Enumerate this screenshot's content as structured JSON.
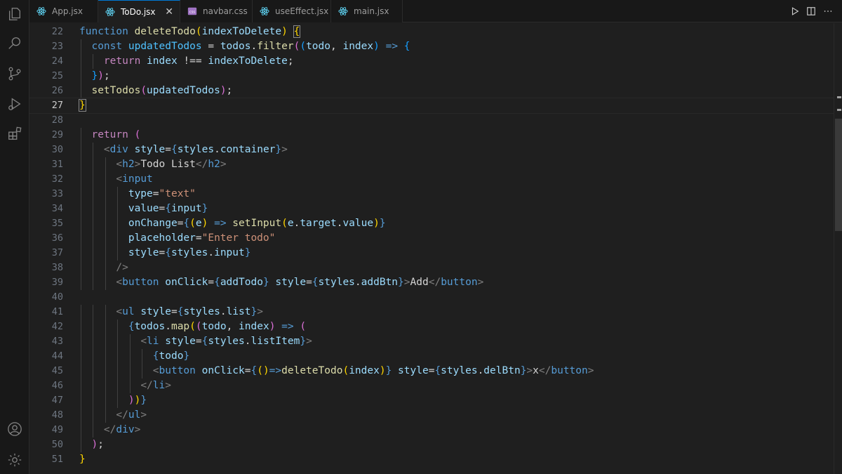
{
  "tabs": [
    {
      "label": "App.jsx",
      "icon": "react-icon",
      "active": false
    },
    {
      "label": "ToDo.jsx",
      "icon": "react-icon",
      "active": true
    },
    {
      "label": "navbar.css",
      "icon": "css-file-icon",
      "active": false
    },
    {
      "label": "useEffect.jsx",
      "icon": "react-icon",
      "active": false
    },
    {
      "label": "main.jsx",
      "icon": "react-icon",
      "active": false
    }
  ],
  "close_glyph": "✕",
  "activity_icons": [
    "explorer-icon",
    "search-icon",
    "source-control-icon",
    "run-debug-icon",
    "extensions-icon",
    "account-icon",
    "settings-gear-icon"
  ],
  "editor": {
    "current_line": "27",
    "lines": [
      {
        "n": "22",
        "tokens": [
          [
            "function",
            "t-kw"
          ],
          [
            " ",
            "t-text"
          ],
          [
            "deleteTodo",
            "t-fn"
          ],
          [
            "(",
            "t-b1"
          ],
          [
            "indexToDelete",
            "t-var"
          ],
          [
            ")",
            "t-b1"
          ],
          [
            " ",
            "t-text"
          ],
          [
            "{",
            "t-b1 t-bm"
          ]
        ]
      },
      {
        "n": "23",
        "tokens": [
          [
            "  ",
            "t-text"
          ],
          [
            "const",
            "t-kw"
          ],
          [
            " ",
            "t-text"
          ],
          [
            "updatedTodos",
            "t-const"
          ],
          [
            " = ",
            "t-punc"
          ],
          [
            "todos",
            "t-var"
          ],
          [
            ".",
            "t-punc"
          ],
          [
            "filter",
            "t-fn"
          ],
          [
            "(",
            "t-b2"
          ],
          [
            "(",
            "t-b3"
          ],
          [
            "todo",
            "t-var"
          ],
          [
            ", ",
            "t-punc"
          ],
          [
            "index",
            "t-var"
          ],
          [
            ")",
            "t-b3"
          ],
          [
            " => ",
            "t-kw"
          ],
          [
            "{",
            "t-b3"
          ]
        ]
      },
      {
        "n": "24",
        "tokens": [
          [
            "    ",
            "t-text"
          ],
          [
            "return",
            "t-ctl"
          ],
          [
            " ",
            "t-text"
          ],
          [
            "index",
            "t-var"
          ],
          [
            " !== ",
            "t-punc"
          ],
          [
            "indexToDelete",
            "t-var"
          ],
          [
            ";",
            "t-punc"
          ]
        ]
      },
      {
        "n": "25",
        "tokens": [
          [
            "  ",
            "t-text"
          ],
          [
            "}",
            "t-b3"
          ],
          [
            ")",
            "t-b2"
          ],
          [
            ";",
            "t-punc"
          ]
        ]
      },
      {
        "n": "26",
        "tokens": [
          [
            "  ",
            "t-text"
          ],
          [
            "setTodos",
            "t-fn"
          ],
          [
            "(",
            "t-b2"
          ],
          [
            "updatedTodos",
            "t-var"
          ],
          [
            ")",
            "t-b2"
          ],
          [
            ";",
            "t-punc"
          ]
        ]
      },
      {
        "n": "27",
        "tokens": [
          [
            "}",
            "t-b1 t-bm"
          ]
        ]
      },
      {
        "n": "28",
        "tokens": []
      },
      {
        "n": "29",
        "tokens": [
          [
            "  ",
            "t-text"
          ],
          [
            "return",
            "t-ctl"
          ],
          [
            " ",
            "t-text"
          ],
          [
            "(",
            "t-b2"
          ]
        ]
      },
      {
        "n": "30",
        "tokens": [
          [
            "    ",
            "t-text"
          ],
          [
            "<",
            "t-tagp"
          ],
          [
            "div",
            "t-tag"
          ],
          [
            " ",
            "t-text"
          ],
          [
            "style",
            "t-attr"
          ],
          [
            "=",
            "t-punc"
          ],
          [
            "{",
            "t-kw"
          ],
          [
            "styles",
            "t-var"
          ],
          [
            ".",
            "t-punc"
          ],
          [
            "container",
            "t-var"
          ],
          [
            "}",
            "t-kw"
          ],
          [
            ">",
            "t-tagp"
          ]
        ]
      },
      {
        "n": "31",
        "tokens": [
          [
            "      ",
            "t-text"
          ],
          [
            "<",
            "t-tagp"
          ],
          [
            "h2",
            "t-tag"
          ],
          [
            ">",
            "t-tagp"
          ],
          [
            "Todo List",
            "t-text"
          ],
          [
            "</",
            "t-tagp"
          ],
          [
            "h2",
            "t-tag"
          ],
          [
            ">",
            "t-tagp"
          ]
        ]
      },
      {
        "n": "32",
        "tokens": [
          [
            "      ",
            "t-text"
          ],
          [
            "<",
            "t-tagp"
          ],
          [
            "input",
            "t-tag"
          ]
        ]
      },
      {
        "n": "33",
        "tokens": [
          [
            "        ",
            "t-text"
          ],
          [
            "type",
            "t-attr"
          ],
          [
            "=",
            "t-punc"
          ],
          [
            "\"text\"",
            "t-str"
          ]
        ]
      },
      {
        "n": "34",
        "tokens": [
          [
            "        ",
            "t-text"
          ],
          [
            "value",
            "t-attr"
          ],
          [
            "=",
            "t-punc"
          ],
          [
            "{",
            "t-kw"
          ],
          [
            "input",
            "t-var"
          ],
          [
            "}",
            "t-kw"
          ]
        ]
      },
      {
        "n": "35",
        "tokens": [
          [
            "        ",
            "t-text"
          ],
          [
            "onChange",
            "t-attr"
          ],
          [
            "=",
            "t-punc"
          ],
          [
            "{",
            "t-kw"
          ],
          [
            "(",
            "t-b1"
          ],
          [
            "e",
            "t-var"
          ],
          [
            ")",
            "t-b1"
          ],
          [
            " => ",
            "t-kw"
          ],
          [
            "setInput",
            "t-fn"
          ],
          [
            "(",
            "t-b1"
          ],
          [
            "e",
            "t-var"
          ],
          [
            ".",
            "t-punc"
          ],
          [
            "target",
            "t-var"
          ],
          [
            ".",
            "t-punc"
          ],
          [
            "value",
            "t-var"
          ],
          [
            ")",
            "t-b1"
          ],
          [
            "}",
            "t-kw"
          ]
        ]
      },
      {
        "n": "36",
        "tokens": [
          [
            "        ",
            "t-text"
          ],
          [
            "placeholder",
            "t-attr"
          ],
          [
            "=",
            "t-punc"
          ],
          [
            "\"Enter todo\"",
            "t-str"
          ]
        ]
      },
      {
        "n": "37",
        "tokens": [
          [
            "        ",
            "t-text"
          ],
          [
            "style",
            "t-attr"
          ],
          [
            "=",
            "t-punc"
          ],
          [
            "{",
            "t-kw"
          ],
          [
            "styles",
            "t-var"
          ],
          [
            ".",
            "t-punc"
          ],
          [
            "input",
            "t-var"
          ],
          [
            "}",
            "t-kw"
          ]
        ]
      },
      {
        "n": "38",
        "tokens": [
          [
            "      ",
            "t-text"
          ],
          [
            "/>",
            "t-tagp"
          ]
        ]
      },
      {
        "n": "39",
        "tokens": [
          [
            "      ",
            "t-text"
          ],
          [
            "<",
            "t-tagp"
          ],
          [
            "button",
            "t-tag"
          ],
          [
            " ",
            "t-text"
          ],
          [
            "onClick",
            "t-attr"
          ],
          [
            "=",
            "t-punc"
          ],
          [
            "{",
            "t-kw"
          ],
          [
            "addTodo",
            "t-var"
          ],
          [
            "}",
            "t-kw"
          ],
          [
            " ",
            "t-text"
          ],
          [
            "style",
            "t-attr"
          ],
          [
            "=",
            "t-punc"
          ],
          [
            "{",
            "t-kw"
          ],
          [
            "styles",
            "t-var"
          ],
          [
            ".",
            "t-punc"
          ],
          [
            "addBtn",
            "t-var"
          ],
          [
            "}",
            "t-kw"
          ],
          [
            ">",
            "t-tagp"
          ],
          [
            "Add",
            "t-text"
          ],
          [
            "</",
            "t-tagp"
          ],
          [
            "button",
            "t-tag"
          ],
          [
            ">",
            "t-tagp"
          ]
        ]
      },
      {
        "n": "40",
        "tokens": []
      },
      {
        "n": "41",
        "tokens": [
          [
            "      ",
            "t-text"
          ],
          [
            "<",
            "t-tagp"
          ],
          [
            "ul",
            "t-tag"
          ],
          [
            " ",
            "t-text"
          ],
          [
            "style",
            "t-attr"
          ],
          [
            "=",
            "t-punc"
          ],
          [
            "{",
            "t-kw"
          ],
          [
            "styles",
            "t-var"
          ],
          [
            ".",
            "t-punc"
          ],
          [
            "list",
            "t-var"
          ],
          [
            "}",
            "t-kw"
          ],
          [
            ">",
            "t-tagp"
          ]
        ]
      },
      {
        "n": "42",
        "tokens": [
          [
            "        ",
            "t-text"
          ],
          [
            "{",
            "t-kw"
          ],
          [
            "todos",
            "t-var"
          ],
          [
            ".",
            "t-punc"
          ],
          [
            "map",
            "t-fn"
          ],
          [
            "(",
            "t-b1"
          ],
          [
            "(",
            "t-b2"
          ],
          [
            "todo",
            "t-var"
          ],
          [
            ", ",
            "t-punc"
          ],
          [
            "index",
            "t-var"
          ],
          [
            ")",
            "t-b2"
          ],
          [
            " => ",
            "t-kw"
          ],
          [
            "(",
            "t-b2"
          ]
        ]
      },
      {
        "n": "43",
        "tokens": [
          [
            "          ",
            "t-text"
          ],
          [
            "<",
            "t-tagp"
          ],
          [
            "li",
            "t-tag"
          ],
          [
            " ",
            "t-text"
          ],
          [
            "style",
            "t-attr"
          ],
          [
            "=",
            "t-punc"
          ],
          [
            "{",
            "t-kw"
          ],
          [
            "styles",
            "t-var"
          ],
          [
            ".",
            "t-punc"
          ],
          [
            "listItem",
            "t-var"
          ],
          [
            "}",
            "t-kw"
          ],
          [
            ">",
            "t-tagp"
          ]
        ]
      },
      {
        "n": "44",
        "tokens": [
          [
            "            ",
            "t-text"
          ],
          [
            "{",
            "t-kw"
          ],
          [
            "todo",
            "t-var"
          ],
          [
            "}",
            "t-kw"
          ]
        ]
      },
      {
        "n": "45",
        "tokens": [
          [
            "            ",
            "t-text"
          ],
          [
            "<",
            "t-tagp"
          ],
          [
            "button",
            "t-tag"
          ],
          [
            " ",
            "t-text"
          ],
          [
            "onClick",
            "t-attr"
          ],
          [
            "=",
            "t-punc"
          ],
          [
            "{",
            "t-kw"
          ],
          [
            "(",
            "t-b1"
          ],
          [
            ")",
            "t-b1"
          ],
          [
            "=>",
            "t-kw"
          ],
          [
            "deleteTodo",
            "t-fn"
          ],
          [
            "(",
            "t-b1"
          ],
          [
            "index",
            "t-var"
          ],
          [
            ")",
            "t-b1"
          ],
          [
            "}",
            "t-kw"
          ],
          [
            " ",
            "t-text"
          ],
          [
            "style",
            "t-attr"
          ],
          [
            "=",
            "t-punc"
          ],
          [
            "{",
            "t-kw"
          ],
          [
            "styles",
            "t-var"
          ],
          [
            ".",
            "t-punc"
          ],
          [
            "delBtn",
            "t-var"
          ],
          [
            "}",
            "t-kw"
          ],
          [
            ">",
            "t-tagp"
          ],
          [
            "x",
            "t-text"
          ],
          [
            "</",
            "t-tagp"
          ],
          [
            "button",
            "t-tag"
          ],
          [
            ">",
            "t-tagp"
          ]
        ]
      },
      {
        "n": "46",
        "tokens": [
          [
            "          ",
            "t-text"
          ],
          [
            "</",
            "t-tagp"
          ],
          [
            "li",
            "t-tag"
          ],
          [
            ">",
            "t-tagp"
          ]
        ]
      },
      {
        "n": "47",
        "tokens": [
          [
            "        ",
            "t-text"
          ],
          [
            ")",
            "t-b2"
          ],
          [
            ")",
            "t-b1"
          ],
          [
            "}",
            "t-kw"
          ]
        ]
      },
      {
        "n": "48",
        "tokens": [
          [
            "      ",
            "t-text"
          ],
          [
            "</",
            "t-tagp"
          ],
          [
            "ul",
            "t-tag"
          ],
          [
            ">",
            "t-tagp"
          ]
        ]
      },
      {
        "n": "49",
        "tokens": [
          [
            "    ",
            "t-text"
          ],
          [
            "</",
            "t-tagp"
          ],
          [
            "div",
            "t-tag"
          ],
          [
            ">",
            "t-tagp"
          ]
        ]
      },
      {
        "n": "50",
        "tokens": [
          [
            "  ",
            "t-text"
          ],
          [
            ")",
            "t-b2"
          ],
          [
            ";",
            "t-punc"
          ]
        ]
      },
      {
        "n": "51",
        "tokens": [
          [
            "}",
            "t-b1"
          ]
        ]
      }
    ]
  }
}
